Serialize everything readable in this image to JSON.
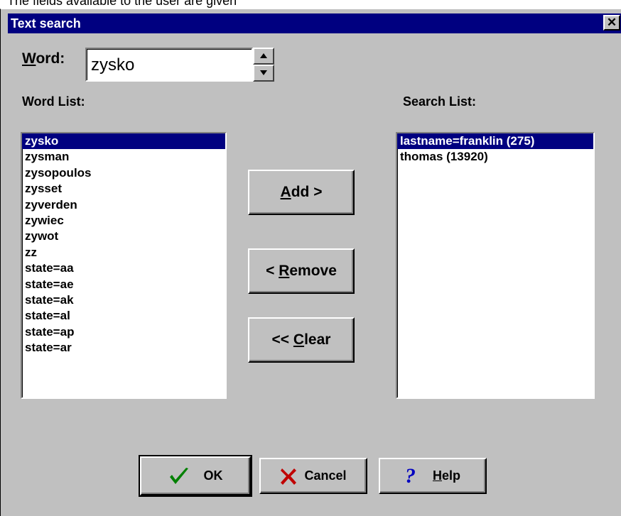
{
  "above_text": "The fields available to the user are given",
  "dialog": {
    "title": "Text search",
    "close_glyph": "✕"
  },
  "word": {
    "label_underlined": "W",
    "label_rest": "ord:",
    "value": "zysko"
  },
  "word_list": {
    "label": "Word List:",
    "items": [
      "zysko",
      "zysman",
      "zysopoulos",
      "zysset",
      "zyverden",
      "zywiec",
      "zywot",
      "zz",
      "state=aa",
      "state=ae",
      "state=ak",
      "state=al",
      "state=ap",
      "state=ar"
    ],
    "selected_index": 0
  },
  "search_list": {
    "label": "Search List:",
    "items": [
      "lastname=franklin (275)",
      "thomas (13920)"
    ],
    "selected_index": 0
  },
  "buttons": {
    "add": {
      "underlined": "A",
      "rest": "dd >"
    },
    "remove": {
      "prefix": "< ",
      "underlined": "R",
      "rest": "emove"
    },
    "clear": {
      "prefix": "<< ",
      "underlined": "C",
      "rest": "lear"
    },
    "ok": {
      "label": "OK",
      "icon": "checkmark-icon"
    },
    "cancel": {
      "label": "Cancel",
      "icon": "x-icon"
    },
    "help": {
      "underlined": "H",
      "rest": "elp",
      "icon": "question-icon"
    }
  },
  "colors": {
    "titlebar": "#000080",
    "selection": "#000080",
    "dialog_face": "#c0c0c0",
    "check_green": "#008000",
    "cancel_red": "#c00000",
    "help_blue": "#0000c0"
  }
}
